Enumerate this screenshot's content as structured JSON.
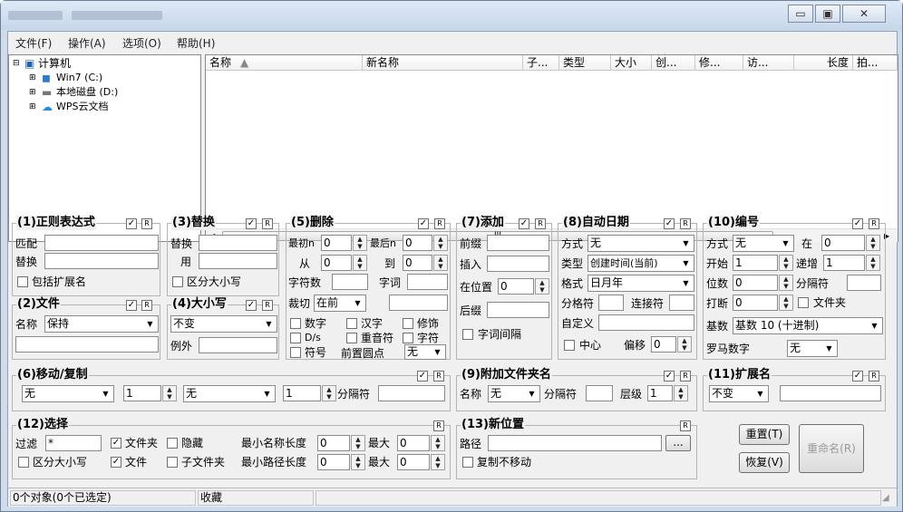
{
  "window": {
    "caption_buttons": [
      "▭",
      "▣",
      "✕"
    ]
  },
  "menu": [
    "文件(F)",
    "操作(A)",
    "选项(O)",
    "帮助(H)"
  ],
  "tree": {
    "root": "计算机",
    "items": [
      "Win7 (C:)",
      "本地磁盘 (D:)",
      "WPS云文档"
    ]
  },
  "columns": [
    "名称",
    "新名称",
    "子...",
    "类型",
    "大小",
    "创...",
    "修...",
    "访...",
    "长度",
    "拍..."
  ],
  "scroll_label": "III",
  "g1": {
    "title": "(1)正则表达式",
    "r": "R",
    "match": "匹配",
    "replace": "替换",
    "ext": "包括扩展名"
  },
  "g2": {
    "title": "(2)文件",
    "r": "R",
    "name": "名称",
    "value": "保持"
  },
  "g3": {
    "title": "(3)替换",
    "r": "R",
    "replace": "替换",
    "with": "用",
    "case": "区分大小写"
  },
  "g4": {
    "title": "(4)大小写",
    "r": "R",
    "value": "不变",
    "except": "例外"
  },
  "g5": {
    "title": "(5)删除",
    "r": "R",
    "first": "最初n",
    "first_v": "0",
    "last": "最后n",
    "last_v": "0",
    "from": "从",
    "from_v": "0",
    "to": "到",
    "to_v": "0",
    "chars": "字符数",
    "words": "字词",
    "crop": "裁切",
    "crop_v": "在前",
    "digits": "数字",
    "hanzi": "汉字",
    "mod": "修饰",
    "ds": "D/s",
    "accent": "重音符",
    "symbols": "字符",
    "sym": "符号",
    "lead": "前置圆点",
    "lead_v": "无"
  },
  "g7": {
    "title": "(7)添加",
    "r": "R",
    "prefix": "前缀",
    "insert": "插入",
    "atpos": "在位置",
    "atpos_v": "0",
    "suffix": "后缀",
    "wordsp": "字词间隔"
  },
  "g8": {
    "title": "(8)自动日期",
    "r": "R",
    "mode": "方式",
    "mode_v": "无",
    "type": "类型",
    "type_v": "创建时间(当前)",
    "fmt": "格式",
    "fmt_v": "日月年",
    "sep": "分格符",
    "conn": "连接符",
    "custom": "自定义",
    "center": "中心",
    "offset": "偏移",
    "offset_v": "0"
  },
  "g10": {
    "title": "(10)编号",
    "r": "R",
    "mode": "方式",
    "mode_v": "无",
    "at": "在",
    "at_v": "0",
    "start": "开始",
    "start_v": "1",
    "inc": "递增",
    "inc_v": "1",
    "digits": "位数",
    "digits_v": "0",
    "sep": "分隔符",
    "brk": "打断",
    "brk_v": "0",
    "folder": "文件夹",
    "base": "基数",
    "base_v": "基数 10 (十进制)",
    "roman": "罗马数字",
    "roman_v": "无"
  },
  "g6": {
    "title": "(6)移动/复制",
    "r": "R",
    "a": "无",
    "n1": "1",
    "b": "无",
    "n2": "1",
    "sep": "分隔符"
  },
  "g9": {
    "title": "(9)附加文件夹名",
    "r": "R",
    "name": "名称",
    "name_v": "无",
    "sep": "分隔符",
    "level": "层级",
    "level_v": "1"
  },
  "g11": {
    "title": "(11)扩展名",
    "r": "R",
    "value": "不变"
  },
  "g12": {
    "title": "(12)选择",
    "r": "R",
    "filter": "过滤",
    "filter_v": "*",
    "folders": "文件夹",
    "hidden": "隐藏",
    "minname": "最小名称长度",
    "minname_v": "0",
    "max1": "最大",
    "max1_v": "0",
    "case": "区分大小写",
    "files": "文件",
    "sub": "子文件夹",
    "minpath": "最小路径长度",
    "minpath_v": "0",
    "max2": "最大",
    "max2_v": "0"
  },
  "g13": {
    "title": "(13)新位置",
    "r": "R",
    "path": "路径",
    "browse": "...",
    "copy": "复制不移动"
  },
  "buttons": {
    "reset": "重置(T)",
    "restore": "恢复(V)",
    "rename": "重命名(R)"
  },
  "status": {
    "count": "0个对象(0个已选定)",
    "fav": "收藏"
  }
}
